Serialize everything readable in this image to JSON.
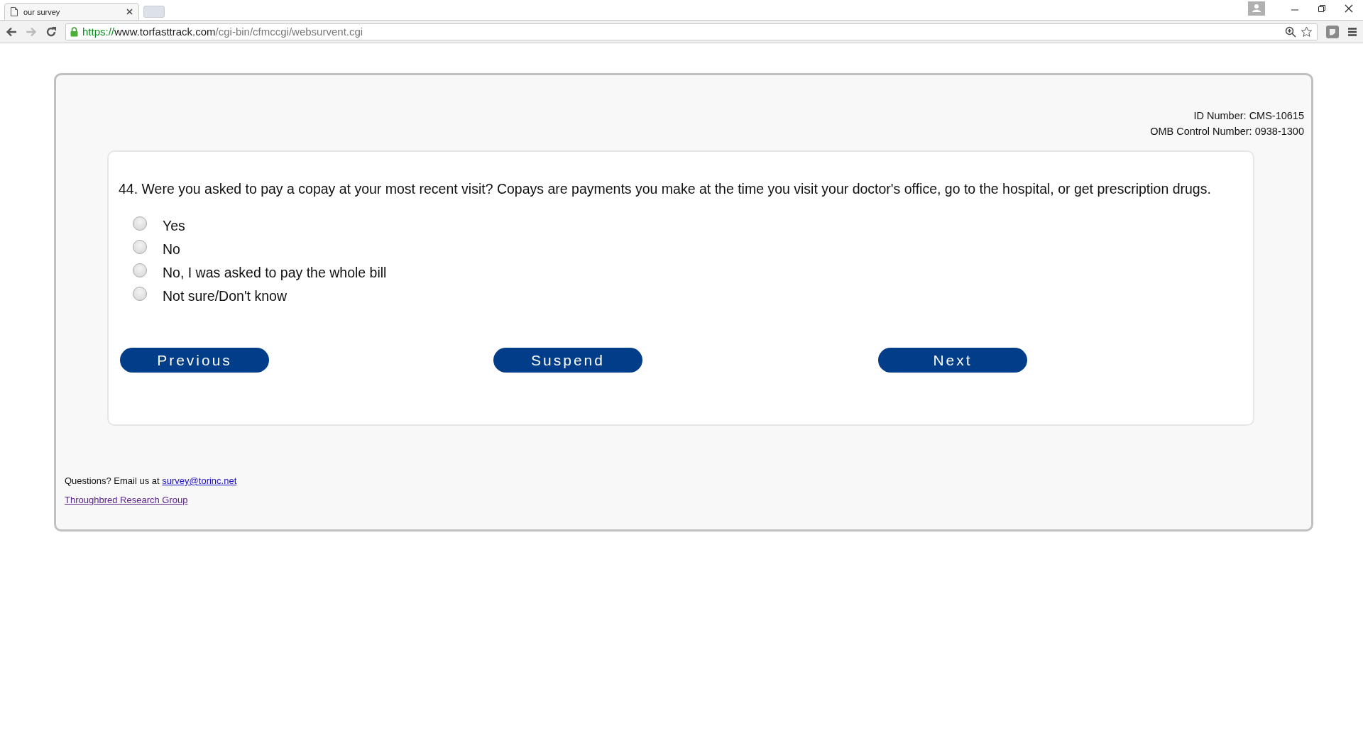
{
  "browser": {
    "tab_title": "our survey",
    "url_scheme": "https://",
    "url_host": "www.torfasttrack.com",
    "url_path": "/cgi-bin/cfmccgi/websurvent.cgi"
  },
  "header": {
    "id_number": "ID Number: CMS-10615",
    "omb_number": "OMB Control Number: 0938-1300"
  },
  "question": {
    "text": "44. Were you asked to pay a copay at your most recent visit? Copays are payments you make at the time you visit your doctor's office, go to the hospital, or get prescription drugs.",
    "options": [
      {
        "label": "Yes",
        "selected": false
      },
      {
        "label": "No",
        "selected": false
      },
      {
        "label": "No, I was asked to pay the whole bill",
        "selected": false
      },
      {
        "label": "Not sure/Don't know",
        "selected": false
      }
    ]
  },
  "buttons": [
    "Previous",
    "Suspend",
    "Next"
  ],
  "footer": {
    "question_text": "Questions? Email us at",
    "email": "survey@torinc.net",
    "company_link": "Throughbred Research Group"
  }
}
